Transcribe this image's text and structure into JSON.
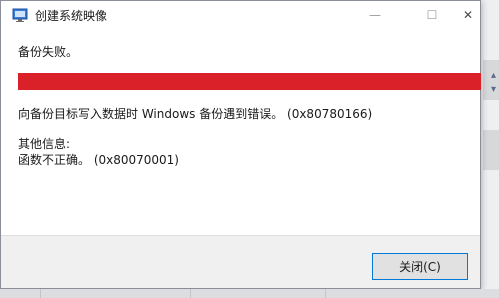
{
  "window": {
    "title": "创建系统映像",
    "minimize_glyph": "—",
    "maximize_glyph": "☐",
    "close_glyph": "✕"
  },
  "status": {
    "text": "备份失败。"
  },
  "progress": {
    "fraction": 1.0,
    "color": "#da2129"
  },
  "error": {
    "message": "向备份目标写入数据时 Windows 备份遇到错误。 (0x80780166)"
  },
  "details": {
    "label": "其他信息:",
    "message": "函数不正确。 (0x80070001)"
  },
  "buttons": {
    "close_label": "关闭(C)"
  },
  "colors": {
    "accent": "#0078d7",
    "error": "#da2129"
  }
}
